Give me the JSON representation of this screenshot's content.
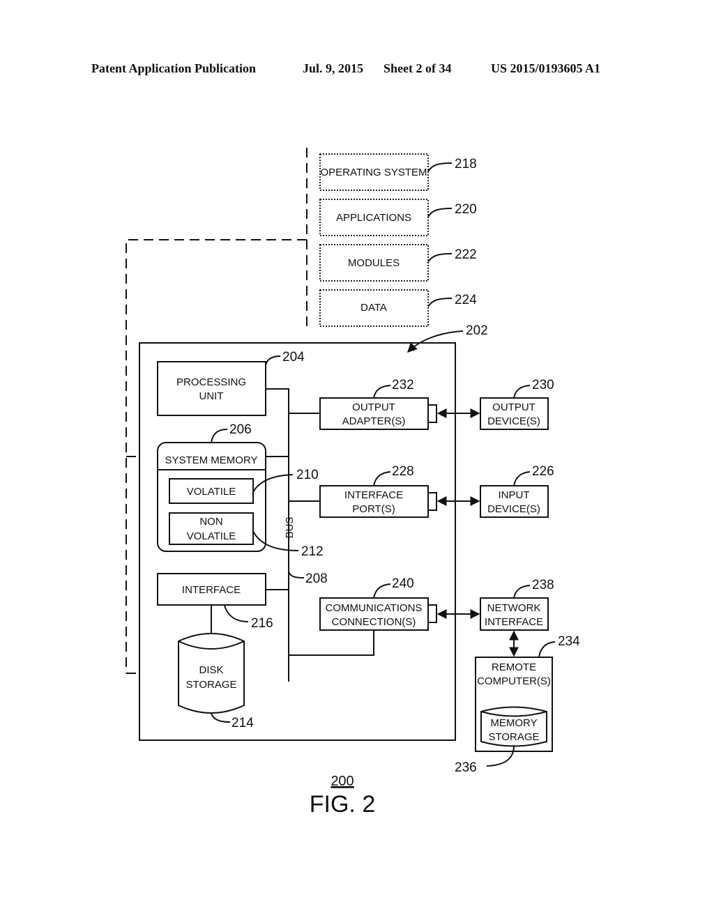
{
  "header": {
    "publication": "Patent Application Publication",
    "date": "Jul. 9, 2015",
    "sheet": "Sheet 2 of 34",
    "number": "US 2015/0193605 A1"
  },
  "software": {
    "os": {
      "label": "OPERATING SYSTEM",
      "ref": "218"
    },
    "apps": {
      "label": "APPLICATIONS",
      "ref": "220"
    },
    "modules": {
      "label": "MODULES",
      "ref": "222"
    },
    "data": {
      "label": "DATA",
      "ref": "224"
    }
  },
  "computer": {
    "ref": "202"
  },
  "processing_unit": {
    "line1": "PROCESSING",
    "line2": "UNIT",
    "ref": "204"
  },
  "system_memory": {
    "label": "SYSTEM MEMORY",
    "ref": "206"
  },
  "volatile": {
    "label": "VOLATILE",
    "ref": "210"
  },
  "nonvolatile": {
    "line1": "NON",
    "line2": "VOLATILE",
    "ref": "212"
  },
  "bus": {
    "label": "BUS",
    "ref": "208"
  },
  "interface": {
    "label": "INTERFACE",
    "ref": "216"
  },
  "disk_storage": {
    "line1": "DISK",
    "line2": "STORAGE",
    "ref": "214"
  },
  "output_adapter": {
    "line1": "OUTPUT",
    "line2": "ADAPTER(S)",
    "ref": "232"
  },
  "interface_port": {
    "line1": "INTERFACE",
    "line2": "PORT(S)",
    "ref": "228"
  },
  "comm_connection": {
    "line1": "COMMUNICATIONS",
    "line2": "CONNECTION(S)",
    "ref": "240"
  },
  "output_device": {
    "line1": "OUTPUT",
    "line2": "DEVICE(S)",
    "ref": "230"
  },
  "input_device": {
    "line1": "INPUT",
    "line2": "DEVICE(S)",
    "ref": "226"
  },
  "network_interface": {
    "line1": "NETWORK",
    "line2": "INTERFACE",
    "ref": "238"
  },
  "remote_computer": {
    "line1": "REMOTE",
    "line2": "COMPUTER(S)",
    "ref": "234"
  },
  "memory_storage": {
    "line1": "MEMORY",
    "line2": "STORAGE",
    "ref": "236"
  },
  "figure": {
    "ref": "200",
    "title": "FIG. 2"
  }
}
